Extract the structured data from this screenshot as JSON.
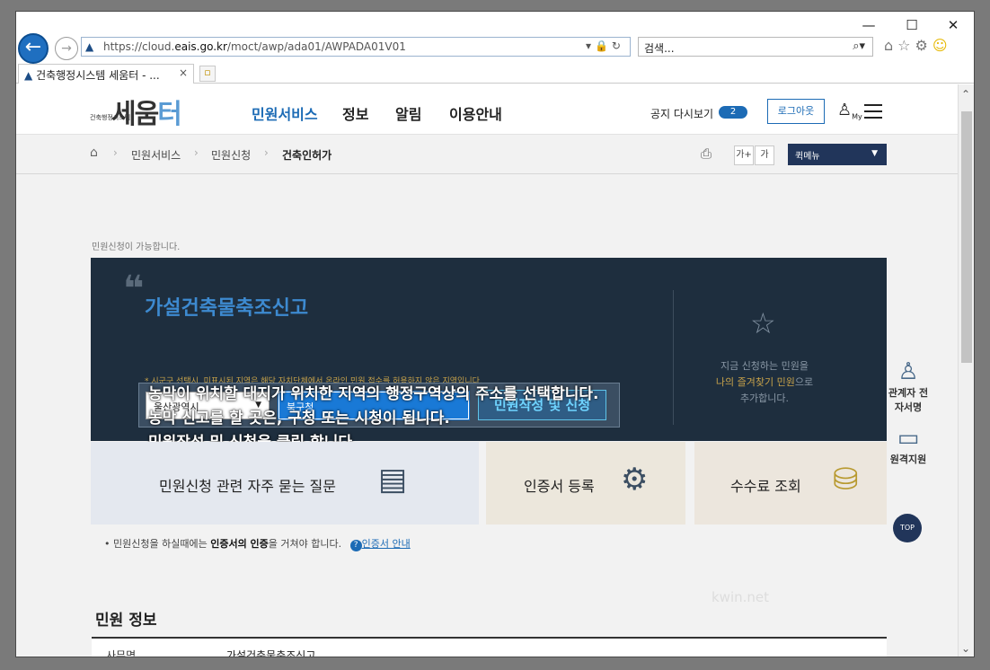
{
  "browser": {
    "url_prefix": "https://cloud.",
    "url_domain": "eais.go.kr",
    "url_path": "/moct/awp/ada01/AWPADA01V01",
    "search_placeholder": "검색...",
    "tab_title": "건축행정시스템 세움터 - ...",
    "minimize": "—",
    "maximize": "☐",
    "close": "✕"
  },
  "header": {
    "logo_small": "건축행정시스템",
    "logo_big_1": "세움",
    "logo_big_2": "터",
    "nav": [
      "민원서비스",
      "정보",
      "알림",
      "이용안내"
    ],
    "notice_label": "공지 다시보기",
    "notice_count": "2",
    "logout_label": "로그아웃",
    "my_label": "My"
  },
  "breadcrumb": {
    "items": [
      "민원서비스",
      "민원신청",
      "건축인허가"
    ],
    "font_up": "가+",
    "font_down": "가",
    "quickmenu": "퀵메뉴"
  },
  "content": {
    "available_text": "민원신청이 가능합니다.",
    "hero_title": "가설건축물축조신고",
    "hero_hint": "* 시군구 선택시, 미표시된 지역은 해당 자치단체에서 온라인 민원 접수를 허용하지 않은 지역입니다.",
    "select_sido": "울산광역시",
    "select_sigungu": "북구청",
    "apply_button": "민원작성 및 신청",
    "fav_line1": "지금 신청하는 민원을",
    "fav_line2_hl": "나의 즐겨찾기 민원",
    "fav_line2_rest": "으로",
    "fav_line3": "추가합니다.",
    "cards": [
      "민원신청 관련 자주 묻는 질문",
      "인증서 등록",
      "수수료 조회"
    ],
    "side": [
      "관계자 전자서명",
      "원격지원"
    ],
    "top_label": "TOP",
    "cert_note_1": "민원신청을 하실때에는 ",
    "cert_note_bold": "인증서의 인증",
    "cert_note_2": "을 거쳐야 합니다.",
    "cert_link": "인증서 안내",
    "info_title": "민원 정보",
    "info_th": "사무명",
    "info_td": "가설건축물축조신고"
  },
  "overlay": {
    "line1": "농막이 위치할 대지가 위치한 지역의 행정구역상의 주소를 선택합니다.",
    "line2": "농막 신고를 할 곳은, 구청 또는 시청이 됩니다.",
    "line3": "민원작성 및 신청을 클릭 합니다."
  },
  "watermark": "kwin.net"
}
